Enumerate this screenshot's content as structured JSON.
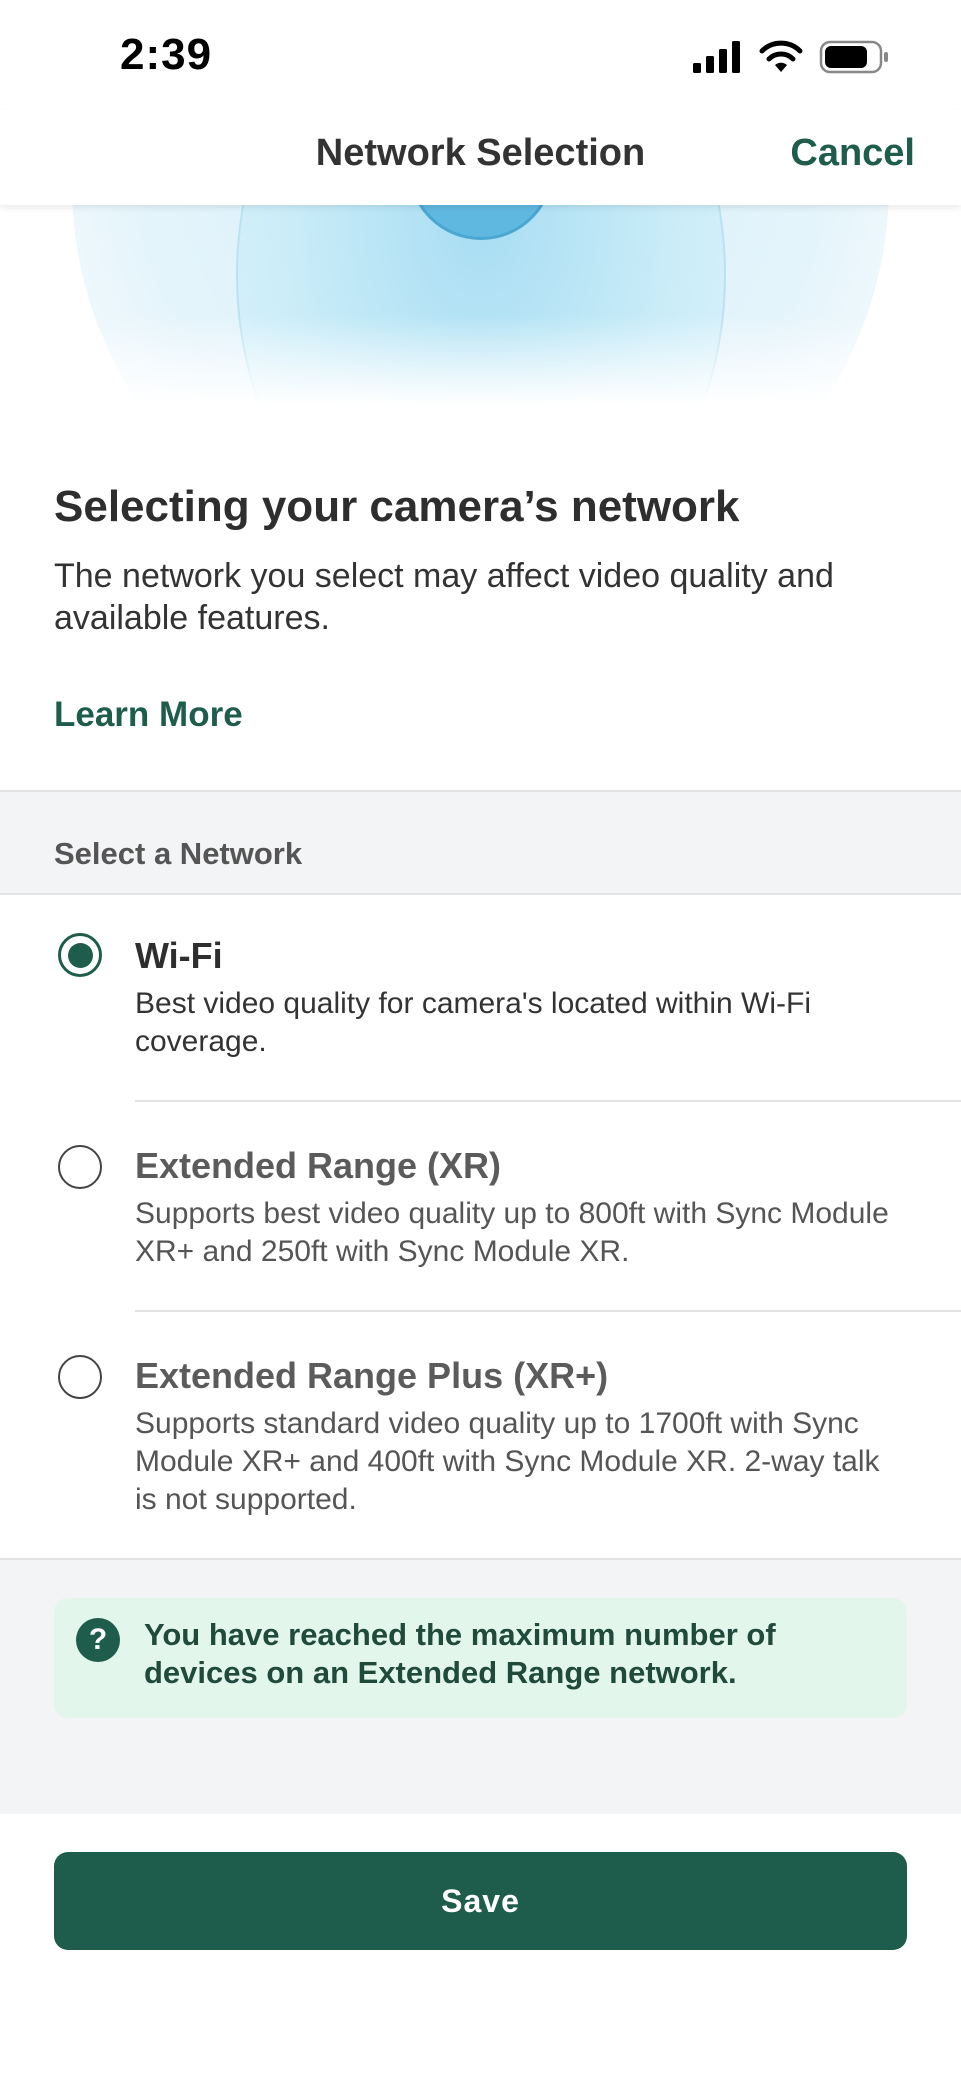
{
  "status_bar": {
    "time": "2:39",
    "icons": [
      "signal-icon",
      "wifi-icon",
      "battery-icon"
    ]
  },
  "nav": {
    "title": "Network Selection",
    "cancel_label": "Cancel"
  },
  "intro": {
    "title": "Selecting your camera’s network",
    "description": "The network you select may affect video quality and available features.",
    "learn_more": "Learn More"
  },
  "section": {
    "label": "Select a Network"
  },
  "options": [
    {
      "title": "Wi-Fi",
      "description": "Best video quality for camera's located within Wi-Fi coverage.",
      "selected": true
    },
    {
      "title": "Extended Range (XR)",
      "description": "Supports best video quality up to 800ft with Sync Module XR+ and 250ft with Sync Module XR.",
      "selected": false
    },
    {
      "title": "Extended Range Plus (XR+)",
      "description": "Supports standard video quality up to 1700ft with Sync Module XR+ and 400ft with Sync Module XR. 2-way talk is not supported.",
      "selected": false
    }
  ],
  "info": {
    "icon_glyph": "?",
    "message": "You have reached the maximum number of devices on an Extended Range network."
  },
  "save_label": "Save",
  "colors": {
    "accent": "#1e5c4b",
    "info_background": "#e3f6ec",
    "section_background": "#f3f4f6"
  }
}
